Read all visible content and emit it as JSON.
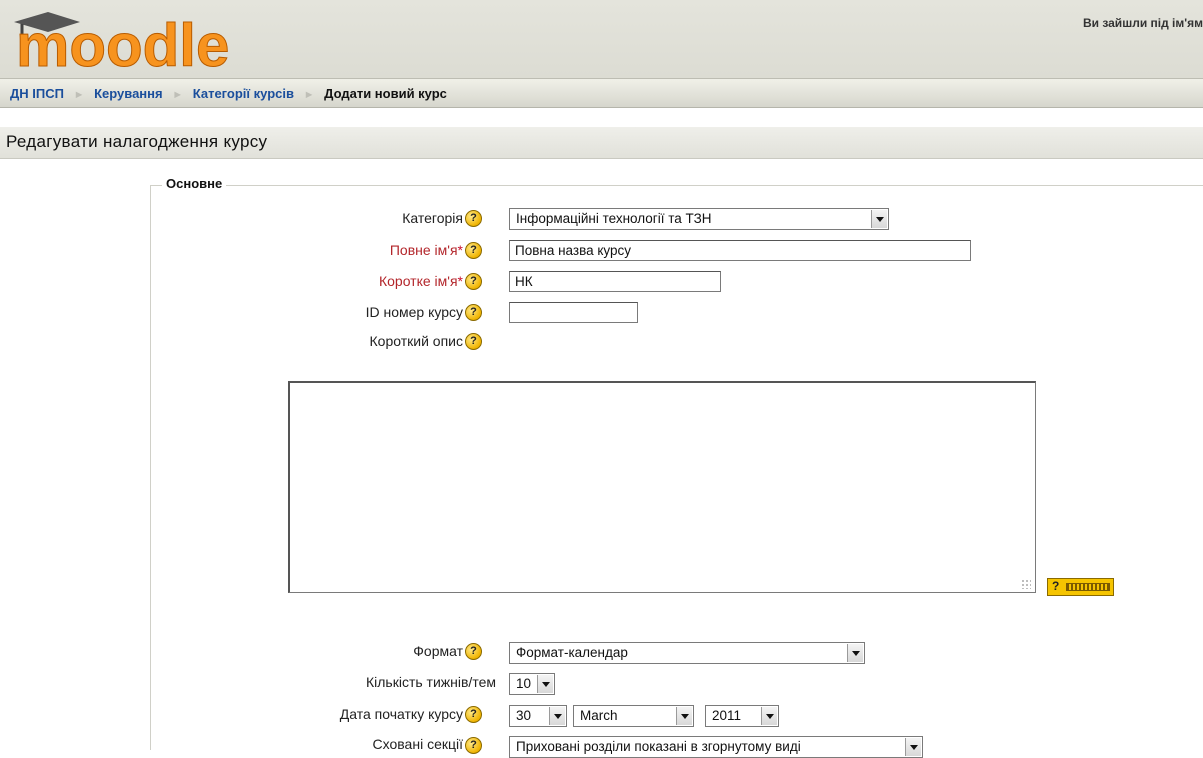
{
  "header": {
    "logo_text": "moodle",
    "login_text": "Ви зайшли під ім'ям"
  },
  "breadcrumb": {
    "items": [
      "ДН ІПСП",
      "Керування",
      "Категорії курсів"
    ],
    "current": "Додати новий курс",
    "separator": "►"
  },
  "page": {
    "title": "Редагувати налагодження курсу"
  },
  "form": {
    "legend": "Основне",
    "help_symbol": "?",
    "required_marker": "*",
    "category": {
      "label": "Категорія",
      "value": "Інформаційні технології та ТЗН"
    },
    "fullname": {
      "label": "Повне ім'я",
      "value": "Повна назва курсу"
    },
    "shortname": {
      "label": "Коротке ім'я",
      "value": "НК"
    },
    "idnumber": {
      "label": "ID номер курсу",
      "value": ""
    },
    "summary": {
      "label": "Короткий опис",
      "value": ""
    },
    "format": {
      "label": "Формат",
      "value": "Формат-календар"
    },
    "numsections": {
      "label": "Кількість тижнів/тем",
      "value": "10"
    },
    "startdate": {
      "label": "Дата початку курсу",
      "day": "30",
      "month": "March",
      "year": "2011"
    },
    "hiddensections": {
      "label": "Сховані секції",
      "value": "Приховані розділи показані в згорнутому виді"
    }
  },
  "colors": {
    "link": "#1a4e9c",
    "required_label": "#b3262b",
    "logo_orange": "#f7931e",
    "help_icon": "#f0b400"
  }
}
